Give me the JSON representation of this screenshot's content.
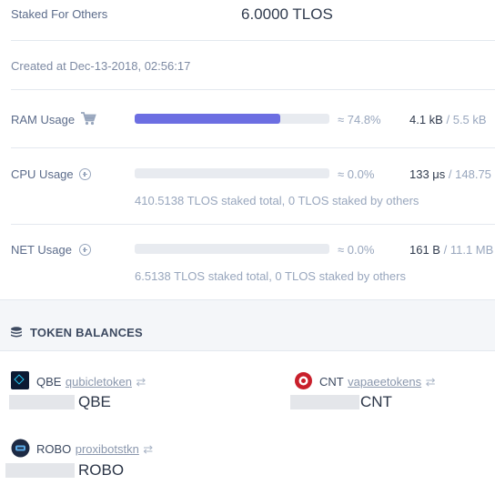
{
  "staked": {
    "label": "Staked For Others",
    "amount": "6.0000",
    "symbol": "TLOS"
  },
  "created": {
    "text": "Created at Dec-13-2018, 02:56:17"
  },
  "ram": {
    "label": "RAM Usage",
    "icon": "cart-icon",
    "percent_text": "≈ 74.8%",
    "fill_percent": 74.8,
    "used": "4.1 kB",
    "total": "/ 5.5 kB"
  },
  "cpu": {
    "label": "CPU Usage",
    "icon": "plus-circle-icon",
    "percent_text": "≈ 0.0%",
    "fill_percent": 0,
    "used": "133 μs",
    "total": "/ 148.75 ms",
    "staked_note": "410.5138 TLOS staked total, 0 TLOS staked by others"
  },
  "net": {
    "label": "NET Usage",
    "icon": "plus-circle-icon",
    "percent_text": "≈ 0.0%",
    "fill_percent": 0,
    "used": "161 B",
    "total": "/ 11.1 MB",
    "staked_note": "6.5138 TLOS staked total, 0 TLOS staked by others"
  },
  "tokens": {
    "section_title": "TOKEN BALANCES",
    "icon": "coins-icon",
    "items": [
      {
        "symbol": "QBE",
        "contract": "qubicletoken",
        "balance_symbol": "QBE",
        "icon": "qbe-logo-icon"
      },
      {
        "symbol": "CNT",
        "contract": "vapaeetokens",
        "balance_symbol": "CNT",
        "icon": "cnt-logo-icon"
      },
      {
        "symbol": "ROBO",
        "contract": "proxibotstkn",
        "balance_symbol": "ROBO",
        "icon": "robo-logo-icon"
      }
    ]
  },
  "colors": {
    "accent": "#6c6ee2",
    "section_bg": "#f4f6f9"
  }
}
